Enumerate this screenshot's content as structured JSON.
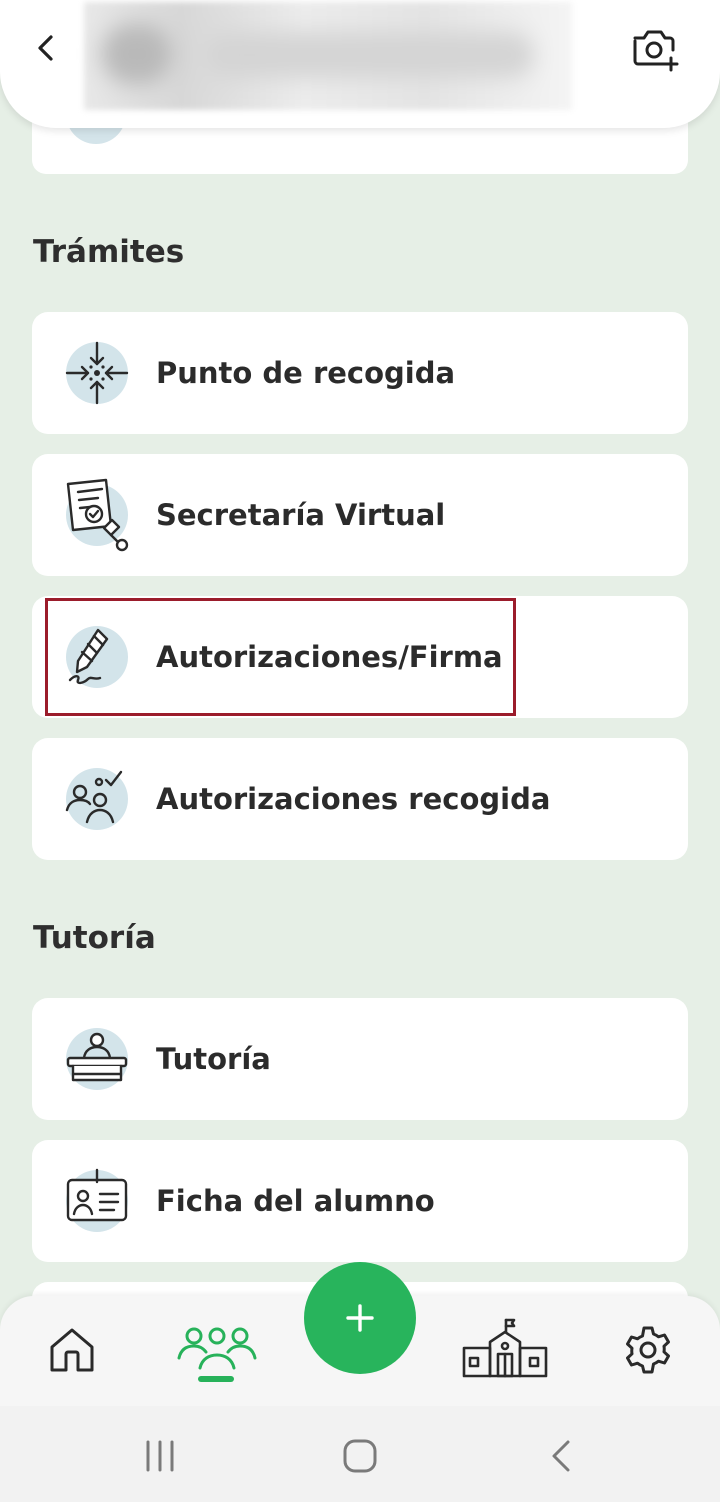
{
  "header": {
    "back_icon": "chevron-left-icon",
    "camera_icon": "camera-add-icon"
  },
  "sections": [
    {
      "title": "Trámites",
      "items": [
        {
          "label": "Punto de recogida",
          "icon": "pickup-point-icon"
        },
        {
          "label": "Secretaría Virtual",
          "icon": "certificate-stamp-icon"
        },
        {
          "label": "Autorizaciones/Firma",
          "icon": "pen-signature-icon",
          "highlighted": true
        },
        {
          "label": "Autorizaciones recogida",
          "icon": "people-check-icon"
        }
      ]
    },
    {
      "title": "Tutoría",
      "items": [
        {
          "label": "Tutoría",
          "icon": "tutor-desk-icon"
        },
        {
          "label": "Ficha del alumno",
          "icon": "student-card-icon"
        }
      ]
    }
  ],
  "bottom_nav": {
    "items": [
      {
        "name": "home",
        "icon": "home-icon",
        "active": false
      },
      {
        "name": "students",
        "icon": "people-group-icon",
        "active": true
      },
      {
        "name": "school",
        "icon": "school-building-icon",
        "active": false
      },
      {
        "name": "settings",
        "icon": "gear-icon",
        "active": false
      }
    ],
    "fab_icon": "plus-icon"
  },
  "colors": {
    "background": "#e6efe6",
    "accent_green": "#28b45c",
    "icon_bubble": "#d3e4ea",
    "highlight_border": "#9b1c2b"
  }
}
